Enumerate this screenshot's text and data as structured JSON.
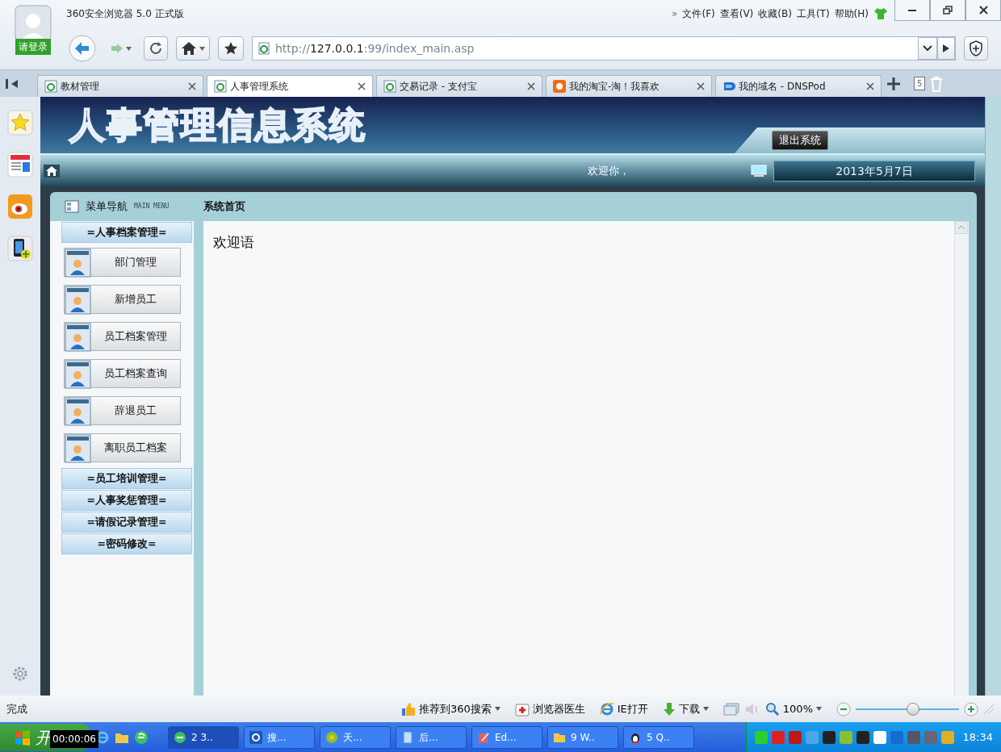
{
  "browser": {
    "login_label": "请登录",
    "title": "360安全浏览器 5.0 正式版",
    "menu_more": "»",
    "menu": [
      "文件(F)",
      "查看(V)",
      "收藏(B)",
      "工具(T)",
      "帮助(H)"
    ],
    "url": "http://**127.0.0.1**:99/index_main.asp"
  },
  "tabs": [
    {
      "label": "教材管理",
      "selected": false,
      "kind": "ie"
    },
    {
      "label": "人事管理系统",
      "selected": true,
      "kind": "ie"
    },
    {
      "label": "交易记录 - 支付宝",
      "selected": false,
      "kind": "ie"
    },
    {
      "label": "我的淘宝-淘！我喜欢",
      "selected": false,
      "kind": "taobao"
    },
    {
      "label": "我的域名 - DNSPod",
      "selected": false,
      "kind": "dnspod"
    }
  ],
  "tab_count": "5",
  "page": {
    "logo_text": "人事管理信息系统",
    "logout": "退出系统",
    "welcome": "欢迎你，",
    "date": "2013年5月7日",
    "menu_title": "菜单导航",
    "menu_subtitle": "MAIN MENU",
    "content_title": "系统首页",
    "content_text": "欢迎语",
    "menu_groups": [
      {
        "label": "=人事档案管理=",
        "items": [
          "部门管理",
          "新增员工",
          "员工档案管理",
          "员工档案查询",
          "辞退员工",
          "离职员工档案"
        ]
      },
      {
        "label": "=员工培训管理="
      },
      {
        "label": "=人事奖惩管理="
      },
      {
        "label": "=请假记录管理="
      },
      {
        "label": "=密码修改="
      }
    ]
  },
  "status_bar": {
    "status": "完成",
    "recommend": "推荐到360搜索",
    "doctor": "浏览器医生",
    "ie_open": "IE打开",
    "download": "下载",
    "zoom": "100%",
    "zoom_slider": {
      "level": 0.56
    }
  },
  "taskbar": {
    "start": "开",
    "tooltip": "00:00:06",
    "tasks": [
      {
        "label": "2 3..",
        "kind": "ie",
        "selected": true
      },
      {
        "label": "搜...",
        "kind": "search",
        "selected": false
      },
      {
        "label": "天...",
        "kind": "green",
        "selected": false
      },
      {
        "label": "后...",
        "kind": "doc",
        "selected": false
      },
      {
        "label": "Ed...",
        "kind": "edit",
        "selected": false
      },
      {
        "label": "9 W..",
        "kind": "folder",
        "selected": false
      },
      {
        "label": "5 Q..",
        "kind": "qq",
        "selected": false
      }
    ],
    "clock": "18:34"
  }
}
